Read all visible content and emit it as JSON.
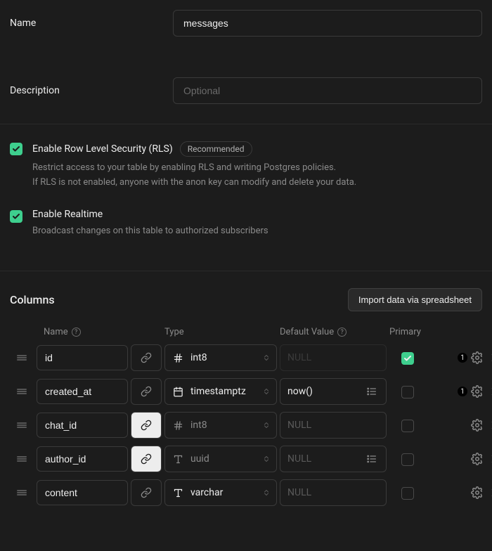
{
  "form": {
    "name_label": "Name",
    "name_value": "messages",
    "description_label": "Description",
    "description_placeholder": "Optional"
  },
  "options": {
    "rls": {
      "checked": true,
      "title": "Enable Row Level Security (RLS)",
      "badge": "Recommended",
      "desc_line1": "Restrict access to your table by enabling RLS and writing Postgres policies.",
      "desc_line2": "If RLS is not enabled, anyone with the anon key can modify and delete your data."
    },
    "realtime": {
      "checked": true,
      "title": "Enable Realtime",
      "desc": "Broadcast changes on this table to authorized subscribers"
    }
  },
  "columns": {
    "title": "Columns",
    "import_btn": "Import data via spreadsheet",
    "headers": {
      "name": "Name",
      "type": "Type",
      "default": "Default Value",
      "primary": "Primary"
    },
    "rows": [
      {
        "name": "id",
        "type": "int8",
        "type_icon": "hash",
        "type_muted": false,
        "link_active": false,
        "default": "NULL",
        "default_null": true,
        "default_disabled": true,
        "show_expr": false,
        "primary": true,
        "settings_count": "1"
      },
      {
        "name": "created_at",
        "type": "timestamptz",
        "type_icon": "calendar",
        "type_muted": false,
        "link_active": false,
        "default": "now()",
        "default_null": false,
        "default_disabled": false,
        "show_expr": true,
        "primary": false,
        "settings_count": "1"
      },
      {
        "name": "chat_id",
        "type": "int8",
        "type_icon": "hash",
        "type_muted": true,
        "link_active": true,
        "default": "NULL",
        "default_null": true,
        "default_disabled": false,
        "show_expr": false,
        "primary": false,
        "settings_count": ""
      },
      {
        "name": "author_id",
        "type": "uuid",
        "type_icon": "text",
        "type_muted": true,
        "link_active": true,
        "default": "NULL",
        "default_null": true,
        "default_disabled": false,
        "show_expr": true,
        "primary": false,
        "settings_count": ""
      },
      {
        "name": "content",
        "type": "varchar",
        "type_icon": "text",
        "type_muted": false,
        "link_active": false,
        "default": "NULL",
        "default_null": true,
        "default_disabled": false,
        "show_expr": false,
        "primary": false,
        "settings_count": ""
      }
    ]
  }
}
